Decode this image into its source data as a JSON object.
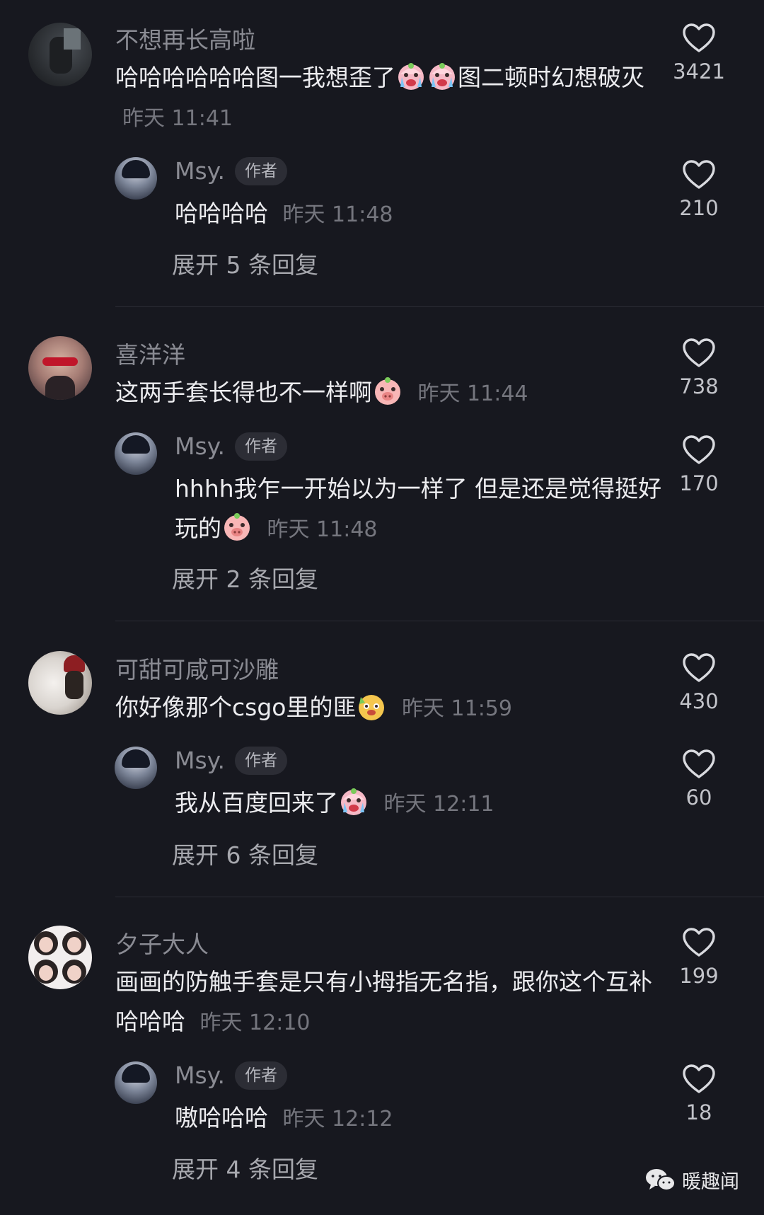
{
  "comments": [
    {
      "user": "不想再长高啦",
      "text_a": "哈哈哈哈哈哈图一我想歪了",
      "text_b": "图二顿时幻想破灭",
      "time": "昨天 11:41",
      "likes": "3421",
      "reply": {
        "user": "Msy.",
        "tag": "作者",
        "text": "哈哈哈哈",
        "time": "昨天 11:48",
        "likes": "210"
      },
      "expand": "展开 5 条回复"
    },
    {
      "user": "喜洋洋",
      "text_a": "这两手套长得也不一样啊",
      "time": "昨天 11:44",
      "likes": "738",
      "reply": {
        "user": "Msy.",
        "tag": "作者",
        "text": "hhhh我乍一开始以为一样了 但是还是觉得挺好玩的",
        "time": "昨天 11:48",
        "likes": "170"
      },
      "expand": "展开 2 条回复"
    },
    {
      "user": "可甜可咸可沙雕",
      "text_a": "你好像那个csgo里的匪",
      "time": "昨天 11:59",
      "likes": "430",
      "reply": {
        "user": "Msy.",
        "tag": "作者",
        "text": "我从百度回来了",
        "time": "昨天 12:11",
        "likes": "60"
      },
      "expand": "展开 6 条回复"
    },
    {
      "user": "夕子大人",
      "text_a": "画画的防触手套是只有小拇指无名指，跟你这个互补哈哈哈",
      "time": "昨天 12:10",
      "likes": "199",
      "reply": {
        "user": "Msy.",
        "tag": "作者",
        "text": "嗷哈哈哈",
        "time": "昨天 12:12",
        "likes": "18"
      },
      "expand": "展开 4 条回复"
    }
  ],
  "icons": {
    "like": "heart-outline-icon",
    "emoji_cry": "crying-face-emoji",
    "emoji_pig": "pig-face-emoji",
    "emoji_dog": "dog-face-emoji",
    "watermark_logo": "wechat-icon"
  },
  "watermark": "暖趣闻",
  "colors": {
    "background": "#17181f",
    "name": "#8a8b93",
    "text": "#ececef",
    "time": "#75767e"
  }
}
